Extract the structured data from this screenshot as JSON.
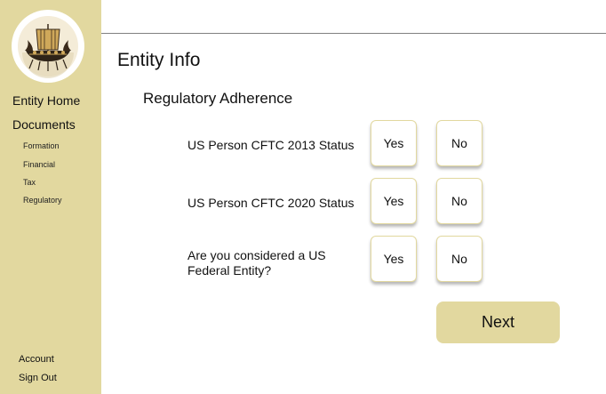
{
  "sidebar": {
    "logo_icon": "viking-ship-logo-icon",
    "nav": {
      "entity_home": "Entity Home",
      "documents": "Documents",
      "sub_items": [
        "Formation",
        "Financial",
        "Tax",
        "Regulatory"
      ]
    },
    "bottom": {
      "account": "Account",
      "sign_out": "Sign Out"
    }
  },
  "main": {
    "title": "Entity Info",
    "section_title": "Regulatory Adherence",
    "questions": [
      {
        "label": "US Person CFTC 2013 Status",
        "yes": "Yes",
        "no": "No"
      },
      {
        "label": "US Person CFTC 2020 Status",
        "yes": "Yes",
        "no": "No"
      },
      {
        "label": "Are you considered a US Federal Entity?",
        "yes": "Yes",
        "no": "No"
      }
    ],
    "next_label": "Next"
  },
  "colors": {
    "sidebar_bg": "#e2d89f",
    "accent": "#e2d89f",
    "divider": "#808080"
  }
}
